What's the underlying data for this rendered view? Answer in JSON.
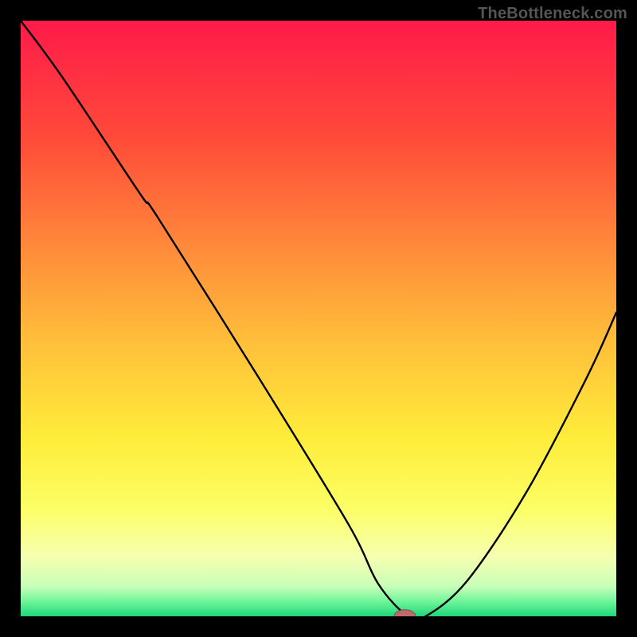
{
  "watermark": "TheBottleneck.com",
  "colors": {
    "bg": "#000000",
    "curve": "#000000",
    "marker_fill": "#bd6b6c",
    "marker_stroke": "#8c4a4b",
    "watermark": "#555555"
  },
  "chart_data": {
    "type": "line",
    "title": "",
    "xlabel": "",
    "ylabel": "",
    "xlim": [
      0,
      100
    ],
    "ylim": [
      0,
      100
    ],
    "grid": false,
    "description": "Bottleneck curve on a red-yellow-green vertical gradient background. One curve descends from top-left to a minimum near x≈64 and rises again.",
    "background_gradient": [
      {
        "stop": 0.0,
        "color": "#ff1a4a"
      },
      {
        "stop": 0.2,
        "color": "#ff4b39"
      },
      {
        "stop": 0.4,
        "color": "#ff913a"
      },
      {
        "stop": 0.55,
        "color": "#ffc23a"
      },
      {
        "stop": 0.7,
        "color": "#ffec3a"
      },
      {
        "stop": 0.82,
        "color": "#fcff66"
      },
      {
        "stop": 0.9,
        "color": "#f6ffb0"
      },
      {
        "stop": 0.95,
        "color": "#c8ffb8"
      },
      {
        "stop": 0.975,
        "color": "#70f59a"
      },
      {
        "stop": 1.0,
        "color": "#1fd67a"
      }
    ],
    "series": [
      {
        "name": "bottleneck-curve",
        "x": [
          0.0,
          7,
          20,
          23,
          40,
          55,
          60,
          65,
          68,
          75,
          85,
          95,
          100
        ],
        "y": [
          100,
          90.5,
          71,
          67,
          40,
          15.5,
          5.5,
          0.0,
          0.0,
          6,
          21,
          40,
          51
        ]
      }
    ],
    "marker": {
      "x": 64.5,
      "y": 0.0,
      "rx": 1.8,
      "ry": 1.1
    }
  }
}
